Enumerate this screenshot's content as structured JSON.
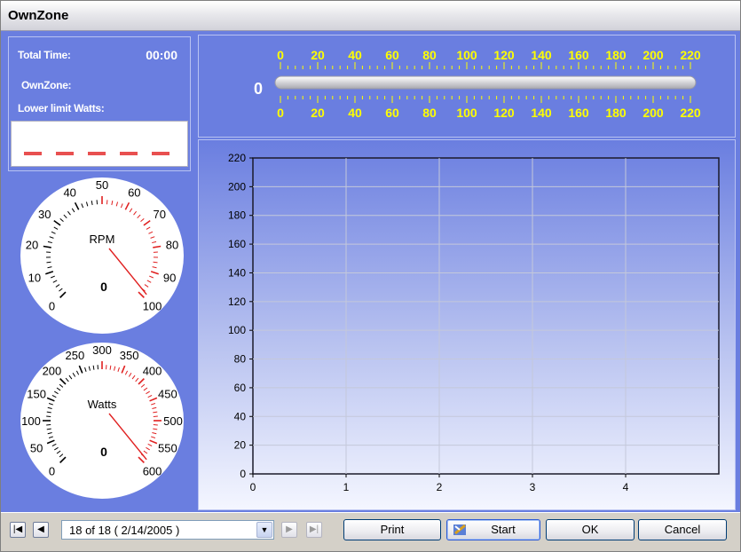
{
  "window": {
    "title": "OwnZone"
  },
  "info": {
    "total_time_label": "Total Time:",
    "total_time_value": "00:00",
    "ownzone_label": "OwnZone:",
    "lower_limit_label": "Lower limit Watts:"
  },
  "rpm_gauge": {
    "label": "RPM",
    "value": 0,
    "ticks": [
      "0",
      "10",
      "20",
      "30",
      "40",
      "50",
      "60",
      "70",
      "80",
      "90",
      "100"
    ],
    "min": 0,
    "max": 100
  },
  "watts_gauge": {
    "label": "Watts",
    "value": 0,
    "ticks": [
      "0",
      "50",
      "100",
      "150",
      "200",
      "250",
      "300",
      "350",
      "400",
      "450",
      "500",
      "550",
      "600"
    ],
    "min": 0,
    "max": 600
  },
  "scale": {
    "value": "0",
    "ticks": [
      "0",
      "20",
      "40",
      "60",
      "80",
      "100",
      "120",
      "140",
      "160",
      "180",
      "200",
      "220"
    ],
    "min": 0,
    "max": 220
  },
  "chart_data": {
    "type": "line",
    "x_ticks": [
      "0",
      "1",
      "2",
      "3",
      "4"
    ],
    "y_ticks": [
      "0",
      "20",
      "40",
      "60",
      "80",
      "100",
      "120",
      "140",
      "160",
      "180",
      "200",
      "220"
    ],
    "xlim": [
      0,
      5
    ],
    "ylim": [
      0,
      220
    ],
    "grid": true,
    "series": []
  },
  "nav": {
    "first_icon": "first-record-icon",
    "prev_icon": "prev-record-icon",
    "next_icon": "next-record-icon",
    "last_icon": "last-record-icon",
    "record_text": "18 of 18  ( 2/14/2005 )"
  },
  "buttons": {
    "print": "Print",
    "start": "Start",
    "ok": "OK",
    "cancel": "Cancel"
  },
  "colors": {
    "panel": "#6a7ee0",
    "scale_text": "#ffff00",
    "gauge_red": "#e02020",
    "dash_red": "#e85050"
  }
}
